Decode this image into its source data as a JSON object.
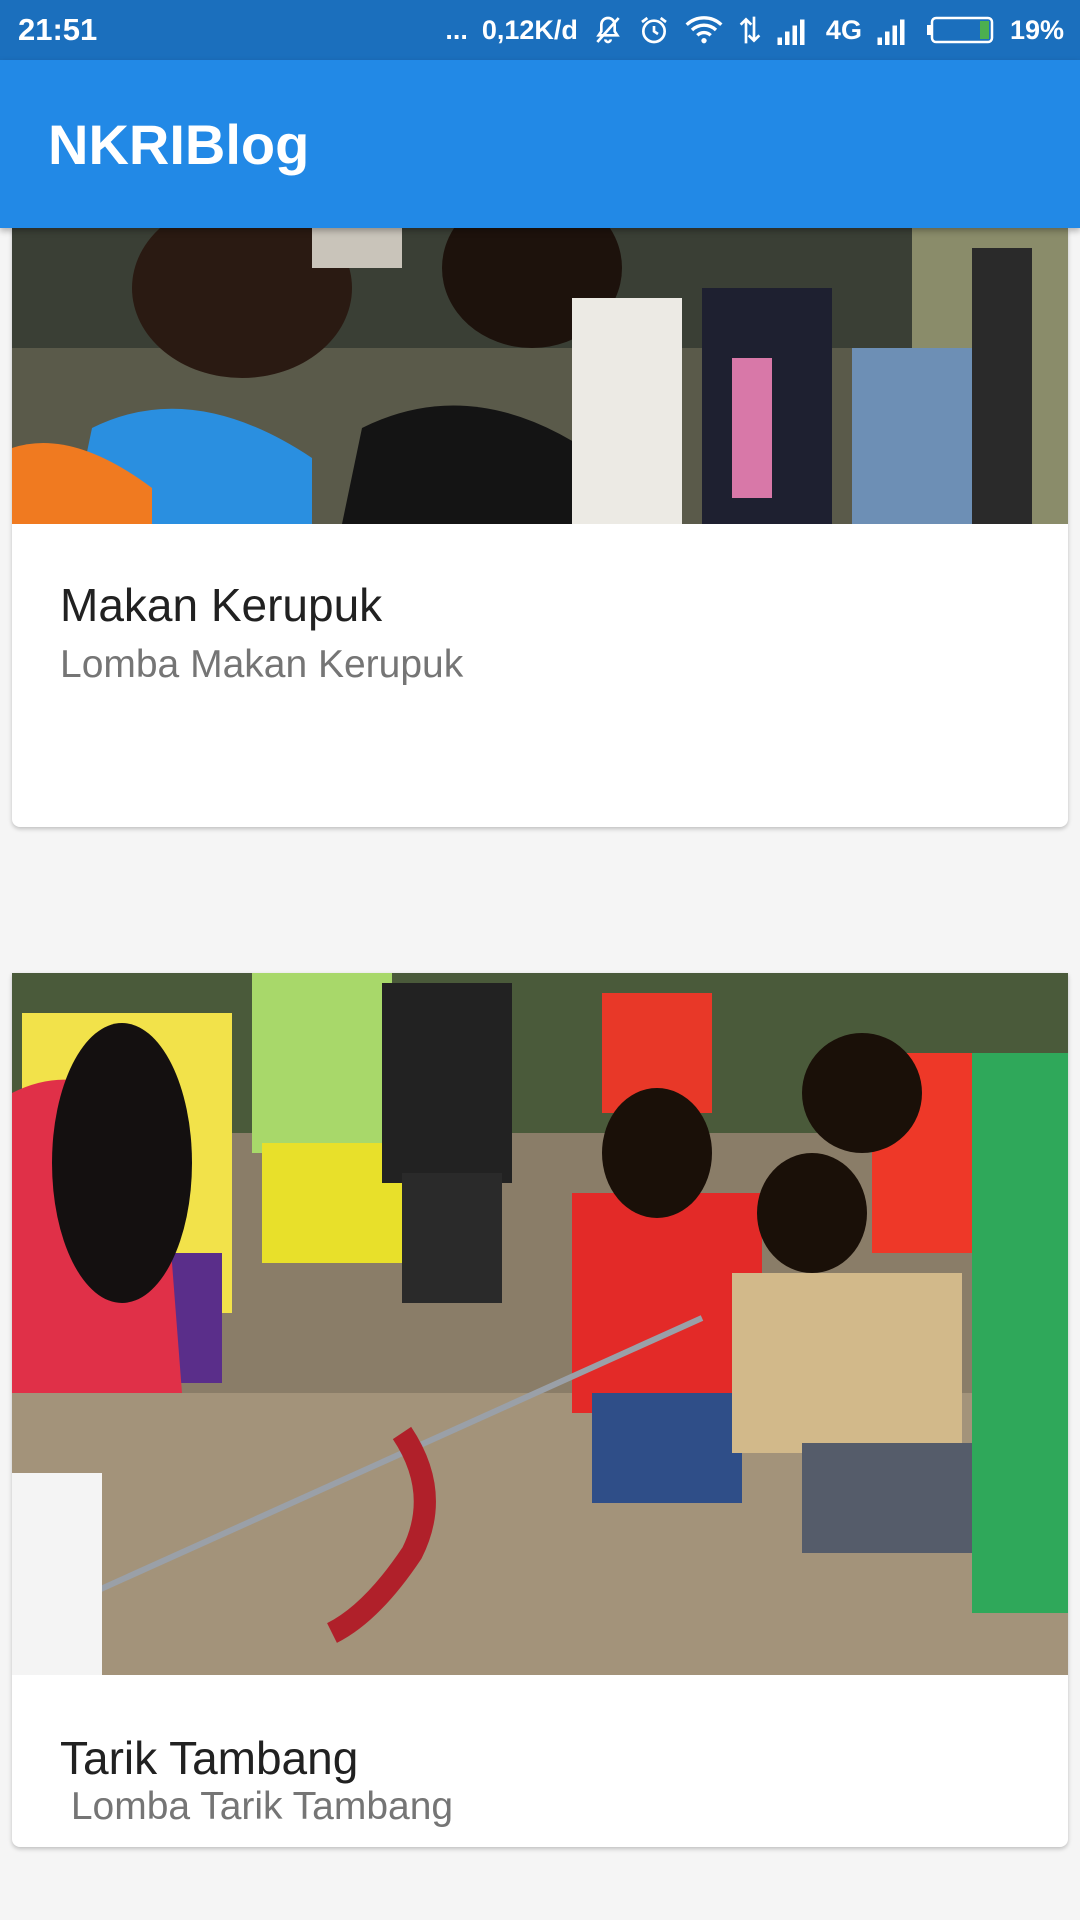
{
  "status_bar": {
    "time": "21:51",
    "dots": "...",
    "speed": "0,12K/d",
    "network": "4G",
    "battery": "19%",
    "icons": [
      "notifications-off-icon",
      "alarm-icon",
      "wifi-icon",
      "data-transfer-icon",
      "signal-icon",
      "signal-icon",
      "battery-icon"
    ],
    "battery_level": 0.19
  },
  "app_bar": {
    "title": "NKRIBlog",
    "color": "#2289e6"
  },
  "cards": [
    {
      "title": "Makan Kerupuk",
      "subtitle": "Lomba Makan Kerupuk"
    },
    {
      "title": "Tarik Tambang",
      "subtitle": " Lomba Tarik Tambang"
    }
  ],
  "colors": {
    "status_bar": "#1b6fbd",
    "background": "#f5f5f5",
    "title_text": "#212121",
    "subtitle_text": "#757575"
  }
}
